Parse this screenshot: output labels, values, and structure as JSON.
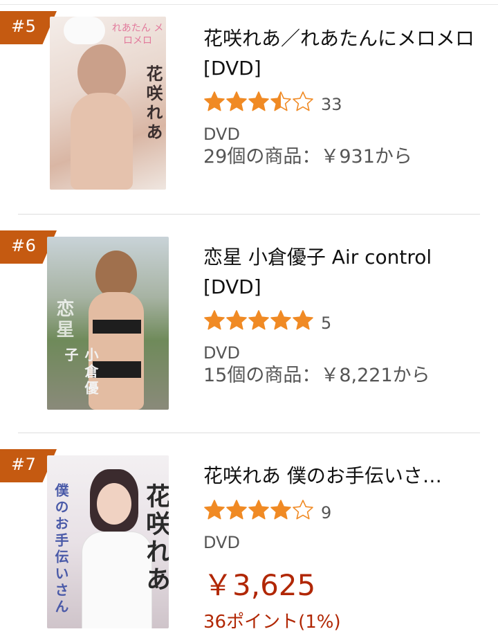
{
  "items": [
    {
      "rank": "#5",
      "title": "花咲れあ／れあたんにメロメロ [DVD]",
      "rating": 3.5,
      "review_count": "33",
      "format": "DVD",
      "offers": "29個の商品：￥931から",
      "cover_text": "花咲れあ",
      "cover_label": "れあたん メロメロ"
    },
    {
      "rank": "#6",
      "title": "恋星 小倉優子 Air control [DVD]",
      "rating": 5,
      "review_count": "5",
      "format": "DVD",
      "offers": "15個の商品：￥8,221から",
      "cover_text": "小倉優子",
      "cover_label": "恋星"
    },
    {
      "rank": "#7",
      "title": "花咲れあ 僕のお手伝いさ…",
      "rating": 4,
      "review_count": "9",
      "format": "DVD",
      "price": "￥3,625",
      "points": "36ポイント(1%)",
      "cover_text": "花咲れあ",
      "cover_label": "僕のお手伝いさん"
    }
  ],
  "colors": {
    "badge": "#c55a11",
    "star": "#f08a24",
    "price": "#b12704"
  }
}
